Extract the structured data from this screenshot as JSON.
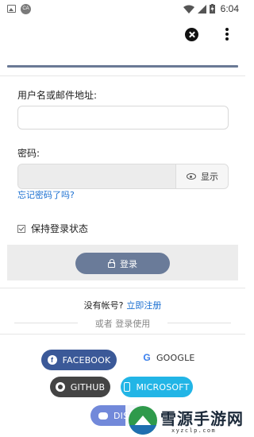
{
  "status_bar": {
    "ca_badge": "CA",
    "time": "6:04"
  },
  "form": {
    "username_label": "用户名或邮件地址:",
    "username_value": "",
    "password_label": "密码:",
    "password_value": "",
    "show_password_label": "显示",
    "forgot_password_link": "忘记密码了吗?",
    "remember_me_label": "保持登录状态",
    "login_button_label": "登录"
  },
  "register": {
    "prompt": "没有帐号?",
    "link": "立即注册"
  },
  "or_login_with": "或者 登录使用",
  "social_buttons": [
    {
      "label": "FACEBOOK",
      "color": "#3b5998"
    },
    {
      "label": "GOOGLE",
      "color": "#ffffff"
    },
    {
      "label": "GITHUB",
      "color": "#444444"
    },
    {
      "label": "MICROSOFT",
      "color": "#22b5e6"
    },
    {
      "label": "DIS",
      "color": "#7289da"
    }
  ],
  "watermark": {
    "title": "雪源手游网",
    "subtitle": "xyzclp.com"
  },
  "colors": {
    "accent": "#6a7b99",
    "link": "#1a6fd1"
  }
}
